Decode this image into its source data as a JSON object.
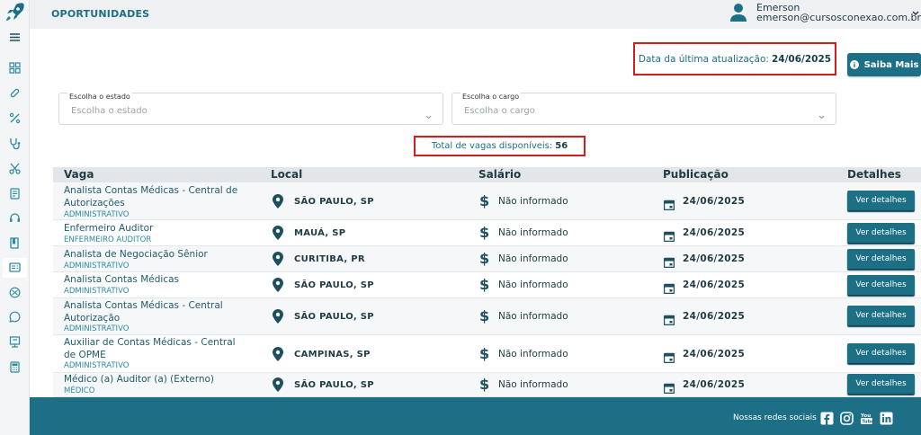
{
  "header": {
    "title": "OPORTUNIDADES",
    "user_name": "Emerson",
    "user_email": "emerson@cursosconexao.com.br"
  },
  "sidebar": {
    "items": [
      {
        "icon": "menu-icon"
      },
      {
        "icon": "dashboard-icon"
      },
      {
        "icon": "pill-icon"
      },
      {
        "icon": "percent-icon"
      },
      {
        "icon": "stethoscope-icon"
      },
      {
        "icon": "scissors-icon"
      },
      {
        "icon": "document-icon"
      },
      {
        "icon": "headset-icon"
      },
      {
        "icon": "book-icon"
      },
      {
        "icon": "jobs-icon",
        "active": true
      },
      {
        "icon": "globe-icon"
      },
      {
        "icon": "chat-icon"
      },
      {
        "icon": "certificate-icon"
      },
      {
        "icon": "calculator-icon"
      }
    ]
  },
  "update": {
    "label": "Data da última atualização:",
    "date": "24/06/2025"
  },
  "info_button": "Saiba Mais",
  "filters": {
    "state": {
      "label": "Escolha o estado",
      "placeholder": "Escolha o estado"
    },
    "role": {
      "label": "Escolha o cargo",
      "placeholder": "Escolha o cargo"
    }
  },
  "total": {
    "label": "Total de vagas disponíveis:",
    "count": "56"
  },
  "table": {
    "columns": [
      "Vaga",
      "Local",
      "Salário",
      "Publicação",
      "Detalhes"
    ],
    "rows": [
      {
        "title": "Analista Contas Médicas - Central de Autorizações",
        "category": "ADMINISTRATIVO",
        "location": "SÃO PAULO, SP",
        "salary": "Não informado",
        "date": "24/06/2025",
        "button": "Ver detalhes"
      },
      {
        "title": "Enfermeiro Auditor",
        "category": "ENFERMEIRO AUDITOR",
        "location": "MAUÁ, SP",
        "salary": "Não informado",
        "date": "24/06/2025",
        "button": "Ver detalhes"
      },
      {
        "title": "Analista de Negociação Sênior",
        "category": "ADMINISTRATIVO",
        "location": "CURITIBA, PR",
        "salary": "Não informado",
        "date": "24/06/2025",
        "button": "Ver detalhes"
      },
      {
        "title": "Analista Contas Médicas",
        "category": "ADMINISTRATIVO",
        "location": "SÃO PAULO, SP",
        "salary": "Não informado",
        "date": "24/06/2025",
        "button": "Ver detalhes"
      },
      {
        "title": "Analista Contas Médicas - Central Autorização",
        "category": "ADMINISTRATIVO",
        "location": "SÃO PAULO, SP",
        "salary": "Não informado",
        "date": "24/06/2025",
        "button": "Ver detalhes"
      },
      {
        "title": "Auxiliar de Contas Médicas - Central de OPME",
        "category": "ADMINISTRATIVO",
        "location": "CAMPINAS, SP",
        "salary": "Não informado",
        "date": "24/06/2025",
        "button": "Ver detalhes"
      },
      {
        "title": "Médico (a) Auditor (a) (Externo)",
        "category": "MÉDICO",
        "location": "SÃO PAULO, SP",
        "salary": "Não informado",
        "date": "24/06/2025",
        "button": "Ver detalhes"
      }
    ]
  },
  "footer": {
    "social_label": "Nossas redes sociais",
    "socials": [
      "facebook-icon",
      "instagram-icon",
      "youtube-icon",
      "linkedin-icon"
    ]
  },
  "colors": {
    "primary": "#1d6f86",
    "highlight_border": "#d11f1f",
    "text_dark": "#1f3b45"
  }
}
